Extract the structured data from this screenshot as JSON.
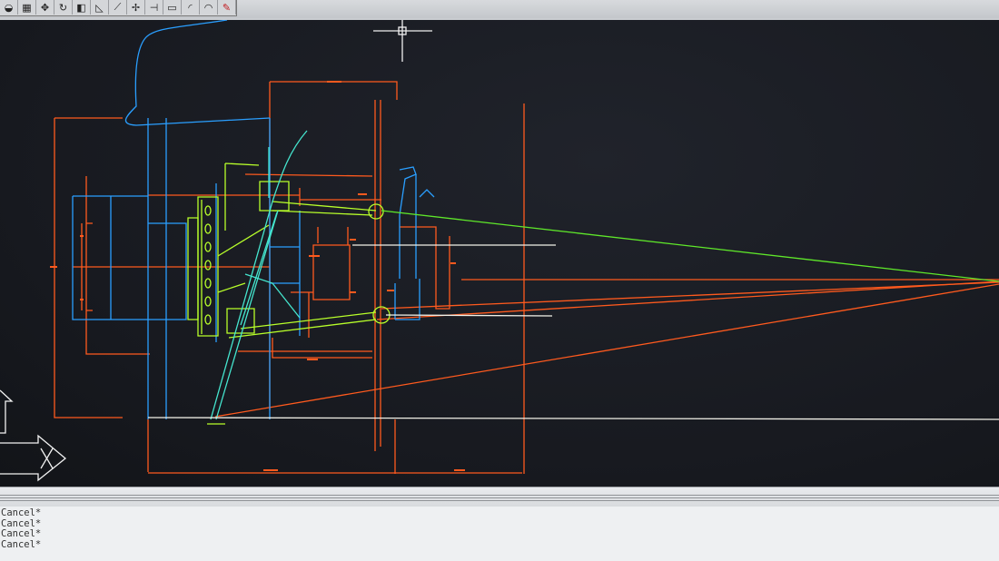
{
  "toolbar": {
    "tools": [
      {
        "name": "pan-eye-icon",
        "glyph": "◒"
      },
      {
        "name": "grid-icon",
        "glyph": "▦"
      },
      {
        "name": "move-icon",
        "glyph": "✥"
      },
      {
        "name": "rotate-icon",
        "glyph": "↻"
      },
      {
        "name": "view-icon",
        "glyph": "◧"
      },
      {
        "name": "shape-icon",
        "glyph": "◺"
      },
      {
        "name": "diagonal-line-icon",
        "glyph": "⟋"
      },
      {
        "name": "cross-line-icon",
        "glyph": "✢"
      },
      {
        "name": "dimension-icon",
        "glyph": "⊣"
      },
      {
        "name": "frame-icon",
        "glyph": "▭"
      },
      {
        "name": "arc-icon",
        "glyph": "◜"
      },
      {
        "name": "curve-icon",
        "glyph": "◠"
      },
      {
        "name": "pencil-icon",
        "glyph": "✎"
      }
    ]
  },
  "colors": {
    "background": "#17191f",
    "orange": "#ff5a1e",
    "cyan": "#2aa8ff",
    "green": "#8cff30",
    "lime": "#c8ff3c",
    "teal": "#40e0c8",
    "white": "#f0f0e8"
  },
  "command_history": [
    "Cancel*",
    "Cancel*",
    "Cancel*",
    "Cancel*"
  ]
}
